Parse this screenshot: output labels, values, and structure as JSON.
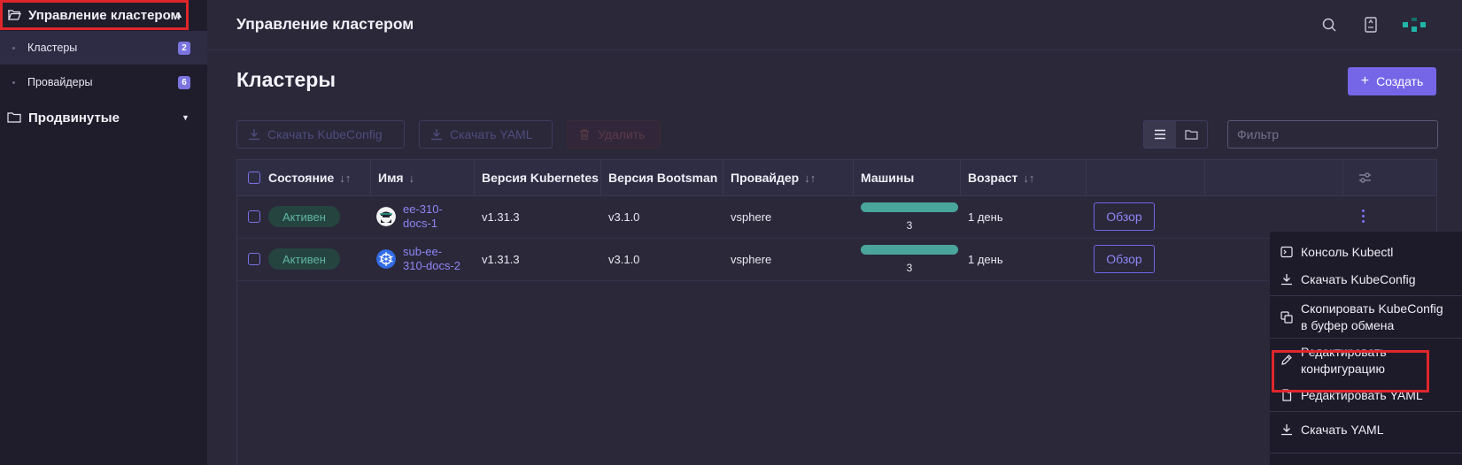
{
  "sidebar": {
    "group_cluster": "Управление кластером",
    "items": [
      {
        "label": "Кластеры",
        "badge": "2"
      },
      {
        "label": "Провайдеры",
        "badge": "6"
      }
    ],
    "group_advanced": "Продвинутые"
  },
  "header": {
    "title": "Управление кластером",
    "icons": [
      "search-icon",
      "book-icon",
      "brand-logo-icon"
    ]
  },
  "page": {
    "title": "Кластеры",
    "create_label": "Создать"
  },
  "toolbar": {
    "download_kubeconfig": "Скачать KubeConfig",
    "download_yaml": "Скачать YAML",
    "delete": "Удалить",
    "filter_placeholder": "Фильтр"
  },
  "table": {
    "columns": [
      "Состояние",
      "Имя",
      "Версия Kubernetes",
      "Версия Bootsman",
      "Провайдер",
      "Машины",
      "Возраст"
    ],
    "rows": [
      {
        "status": "Активен",
        "name_lines": [
          "ee-310-",
          "docs-1"
        ],
        "k8s": "v1.31.3",
        "bootsman": "v3.1.0",
        "provider": "vsphere",
        "machines": "3",
        "age": "1 день",
        "action": "Обзор"
      },
      {
        "status": "Активен",
        "name_lines": [
          "sub-ee-",
          "310-docs-2"
        ],
        "k8s": "v1.31.3",
        "bootsman": "v3.1.0",
        "provider": "vsphere",
        "machines": "3",
        "age": "1 день",
        "action": "Обзор"
      }
    ]
  },
  "context_menu": {
    "items": [
      {
        "label": "Консоль Kubectl"
      },
      {
        "label": "Скачать KubeConfig"
      },
      {
        "label_lines": [
          "Скопировать KubeConfig",
          "в буфер обмена"
        ]
      },
      {
        "label_lines": [
          "Редактировать",
          "конфигурацию"
        ]
      },
      {
        "label": "Редактировать YAML"
      },
      {
        "label": "Скачать YAML"
      }
    ]
  },
  "colors": {
    "accent": "#7566e8",
    "highlight": "#e0262b",
    "status_active": "#5fb5a0"
  }
}
